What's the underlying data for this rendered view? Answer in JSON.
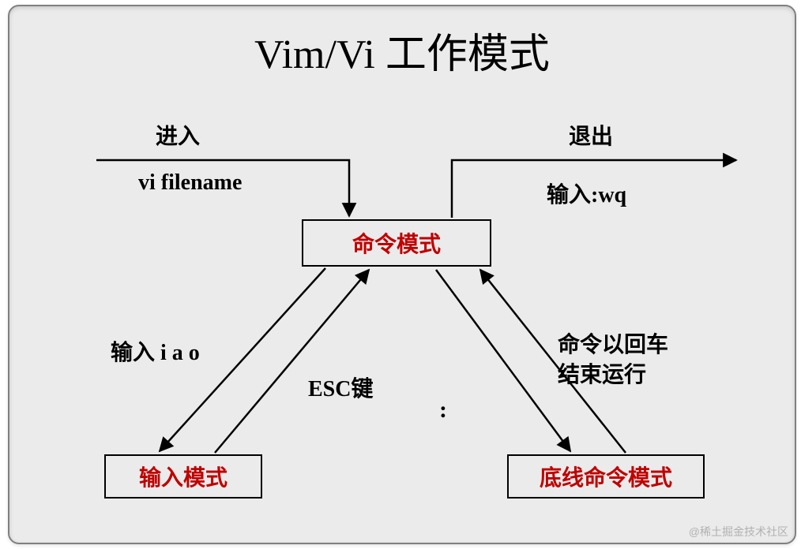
{
  "title": "Vim/Vi 工作模式",
  "nodes": {
    "command": "命令模式",
    "insert": "输入模式",
    "lastline": "底线命令模式"
  },
  "labels": {
    "enter": "进入",
    "enter_cmd": "vi filename",
    "exit": "退出",
    "exit_cmd": "输入:wq",
    "to_insert": "输入 i a o",
    "to_command_esc": "ESC键",
    "to_lastline_colon": ":",
    "lastline_return_l1": "命令以回车",
    "lastline_return_l2": "结束运行"
  },
  "watermark": "@稀土掘金技术社区"
}
